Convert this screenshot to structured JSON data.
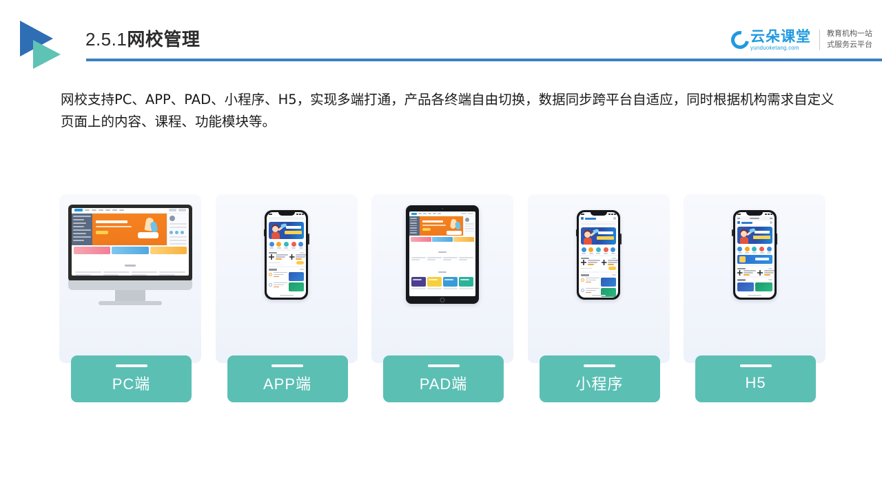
{
  "slide": {
    "title_number": "2.5.1",
    "title_text": "网校管理",
    "body_text": "网校支持PC、APP、PAD、小程序、H5，实现多端打通，产品各终端自由切换，数据同步跨平台自适应，同时根据机构需求自定义页面上的内容、课程、功能模块等。"
  },
  "brand": {
    "name_cn": "云朵课堂",
    "url": "yunduoketang.com",
    "tagline_line1": "教育机构一站",
    "tagline_line2": "式服务云平台",
    "logo_icon": "cloud-icon",
    "color": "#1f9ae0"
  },
  "header": {
    "logo_icon": "double-triangle-play-icon",
    "triangle_dark_color": "#2f6eb5",
    "triangle_teal_color": "#5ec3b4",
    "rule_color": "#3a80c1"
  },
  "theme": {
    "accent_teal": "#5bbfb4",
    "card_bg_top": "#f7f9fd",
    "card_bg_bottom": "#eef2fa",
    "text_color": "#1a1a1a"
  },
  "platform_cards": [
    {
      "id": "pc",
      "label": "PC端",
      "device": "desktop-monitor"
    },
    {
      "id": "app",
      "label": "APP端",
      "device": "smartphone"
    },
    {
      "id": "pad",
      "label": "PAD端",
      "device": "tablet"
    },
    {
      "id": "mini",
      "label": "小程序",
      "device": "smartphone"
    },
    {
      "id": "h5",
      "label": "H5",
      "device": "smartphone-browser"
    }
  ]
}
